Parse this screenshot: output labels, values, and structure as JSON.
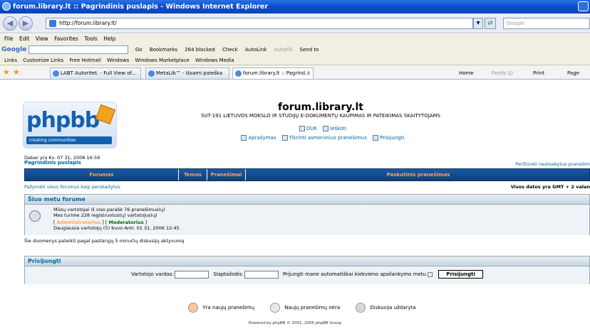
{
  "window": {
    "title": "forum.library.lt :: Pagrindinis puslapis - Windows Internet Explorer"
  },
  "address": {
    "url": "http://forum.library.lt/",
    "search_placeholder": "Google"
  },
  "menu": [
    "File",
    "Edit",
    "View",
    "Favorites",
    "Tools",
    "Help"
  ],
  "googlebar": {
    "logo": "Google",
    "go": "Go",
    "bookmarks": "Bookmarks",
    "blocked": "264 blocked",
    "check": "Check",
    "autolink": "AutoLink",
    "autofill": "AutoFill",
    "sendto": "Send to"
  },
  "links": [
    "Links",
    "Customize Links",
    "Free Hotmail",
    "Windows",
    "Windows Marketplace",
    "Windows Media"
  ],
  "tabs": [
    "LABT Autoritet. - Full View of...",
    "MetaLib™ - Išsami paieška",
    "forum.library.lt :: Pagrind..."
  ],
  "commands": {
    "home": "Home",
    "feeds": "Feeds (J)",
    "print": "Print",
    "page": "Page"
  },
  "forum": {
    "logo_text": "phpbb",
    "logo_sub": "creating   communities",
    "title": "forum.library.lt",
    "description": "SUT-191 LIETUVOS MOKSLO IR STUDIJŲ E-DOKUMENTŲ KAUPIMAS IR PATEIKIMAS SKAITYTOJAMS",
    "nav1": [
      "DUK",
      "Ieškoti"
    ],
    "nav2": [
      "Aprašymas",
      "Tikrinti asmeninius pranešimus",
      "Prisijungti"
    ],
    "datetime": "Dabar yra Kv. 07 31, 2008 16:59",
    "breadcrumb": "Pagrindinis puslapis",
    "unread": "Peržiūrėti neatsakytus pranešim",
    "table_headers": [
      "Forumas",
      "Temos",
      "Pranešimai",
      "Paskutinis pranešimas"
    ],
    "mark_read": "Pažymėti visus forumus kaip perskaitytus",
    "timezone": "Visos datos yra GMT + 2 valan",
    "who_title": "Šiuo metu forume",
    "who_line1": "Mūsų vartotojai iš viso parašė 76 pranešimus(ų)",
    "who_line2": "Mes turime 228 registruotus(ų) vartotojus(ų)",
    "admins": "Administratorius",
    "mods": "Moderatorius",
    "who_line3": "Daugiausia vartotojų (5) buvo Antr. 01 31, 2006 12:45",
    "data_note": "Šie duomenys pateikti pagal pastarųjų 5 minučių diskusijų aktyvumą",
    "login_title": "Prisijungti",
    "username_label": "Vartotojo vardas:",
    "password_label": "Slaptažodis:",
    "autologin_label": "Prijungti mane automatiškai kiekvieno apsilankymo metu",
    "login_button": "Prisijungti",
    "legend_new": "Yra naujų pranešimų",
    "legend_none": "Naujų pranešimų nėra",
    "legend_locked": "Diskusija uždaryta",
    "powered": "Powered by phpBB © 2001, 2005 phpBB Group"
  }
}
